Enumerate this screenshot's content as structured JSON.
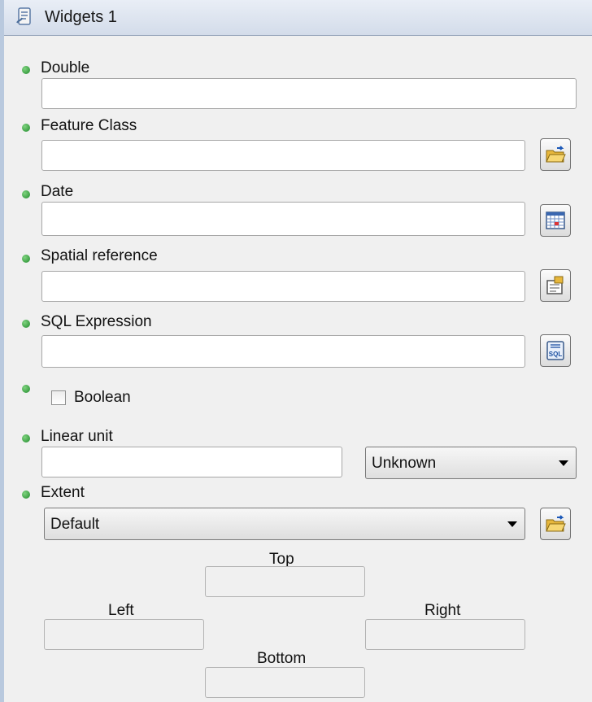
{
  "window": {
    "title": "Widgets 1"
  },
  "fields": {
    "double": {
      "label": "Double",
      "value": ""
    },
    "feature_class": {
      "label": "Feature Class",
      "value": ""
    },
    "date": {
      "label": "Date",
      "value": ""
    },
    "spatial_reference": {
      "label": "Spatial reference",
      "value": ""
    },
    "sql_expression": {
      "label": "SQL Expression",
      "value": ""
    },
    "boolean": {
      "label": "Boolean",
      "checked": false
    },
    "linear_unit": {
      "label": "Linear unit",
      "value": "",
      "unit": "Unknown"
    },
    "extent": {
      "label": "Extent",
      "value": "Default",
      "top_label": "Top",
      "left_label": "Left",
      "right_label": "Right",
      "bottom_label": "Bottom"
    }
  },
  "icons": {
    "title": "script-tool-icon",
    "feature_class_browse": "folder-open-icon",
    "date_picker": "calendar-icon",
    "spatial_reference_properties": "properties-icon",
    "sql_builder": "sql-icon",
    "extent_browse": "folder-open-icon"
  },
  "colors": {
    "required_bullet": "#1f8a2b",
    "window_bg": "#f0f0f0"
  }
}
